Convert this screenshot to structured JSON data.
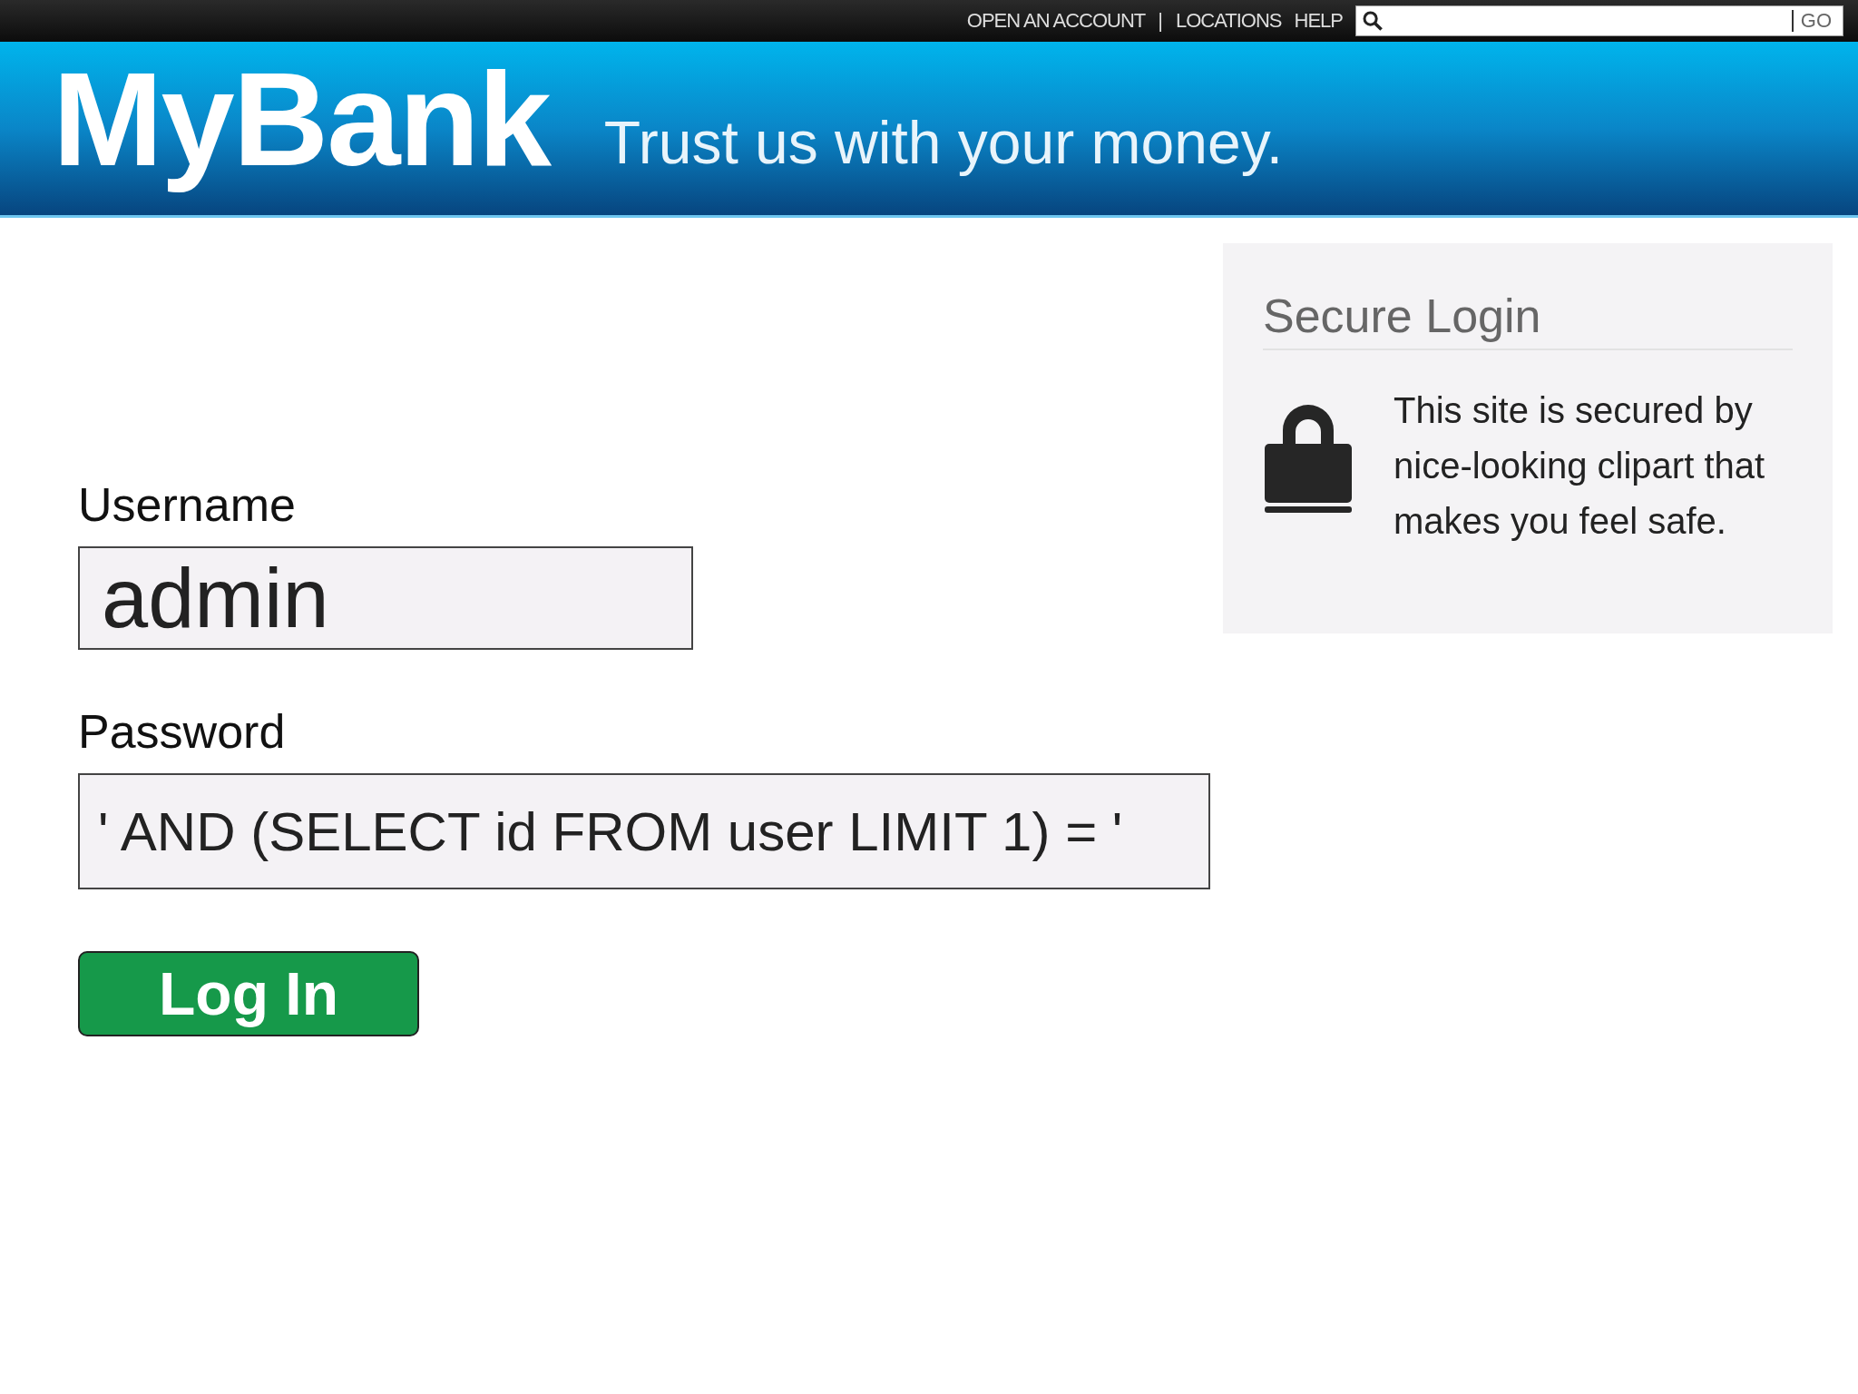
{
  "top_nav": [
    {
      "kind": "link",
      "label": "OPEN AN ACCOUNT"
    },
    {
      "kind": "separator",
      "label": "|"
    },
    {
      "kind": "link",
      "label": "LOCATIONS"
    },
    {
      "kind": "link",
      "label": "HELP"
    }
  ],
  "search": {
    "button": "GO"
  },
  "header": {
    "logo": "MyBank",
    "tagline": "Trust us with your money."
  },
  "form": {
    "fields": [
      {
        "label": "Username",
        "value": "admin",
        "kind": "large"
      },
      {
        "label": "Password",
        "value": "' AND (SELECT id FROM user LIMIT 1) = '",
        "kind": "wide"
      }
    ],
    "submit": "Log In"
  },
  "secure_box": {
    "title": "Secure Login",
    "text": "This site is secured by nice-looking clipart that makes you feel safe."
  }
}
